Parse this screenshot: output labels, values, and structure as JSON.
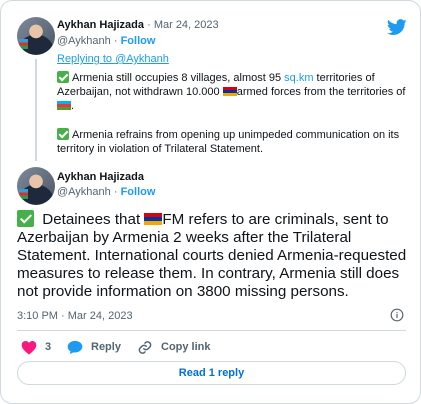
{
  "tweet1": {
    "author_name": "Aykhan Hajizada",
    "separator": "·",
    "date": "Mar 24, 2023",
    "handle": "@Aykhanh",
    "follow_label": "Follow",
    "replying_prefix": "Replying to ",
    "replying_to": "@Aykhanh",
    "line1_a": "Armenia still occupies 8 villages, almost 95 ",
    "line1_link": "sq.km",
    "line1_b": " territories of Azerbaijan, not withdrawn 10.000 ",
    "line1_c": "armed forces from the territories of ",
    "line1_d": ".",
    "line2": "Armenia refrains from opening up unimpeded communication on its territory in violation of Trilateral Statement."
  },
  "tweet2": {
    "author_name": "Aykhan Hajizada",
    "handle": "@Aykhanh",
    "follow_label": "Follow",
    "text_a": " Detainees that ",
    "text_b": "FM refers to are criminals, sent to Azerbaijan by Armenia 2 weeks after the Trilateral Statement. International courts denied Armenia-requested measures to release them. In contrary, Armenia still does not provide information on 3800 missing persons.",
    "time": "3:10 PM",
    "date_sep": "·",
    "date": "Mar 24, 2023"
  },
  "actions": {
    "like_count": "3",
    "reply_label": "Reply",
    "copy_label": "Copy link"
  },
  "read_replies_label": "Read 1 reply",
  "icons": {
    "brand": "twitter-bird-icon",
    "info": "info-icon",
    "like": "heart-icon",
    "reply": "reply-bubble-icon",
    "copy": "link-icon",
    "check": "check-mark-icon",
    "flag_armenia": "armenia-flag-icon",
    "flag_azerbaijan": "azerbaijan-flag-icon"
  },
  "colors": {
    "accent": "#1d9bf0",
    "like": "#f91880",
    "muted": "#536471",
    "link": "#006fd6"
  }
}
